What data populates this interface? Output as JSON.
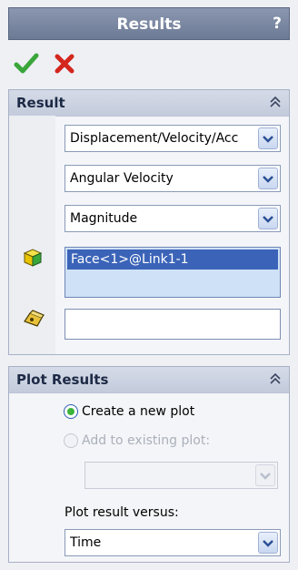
{
  "window": {
    "title": "Results",
    "help_glyph": "?"
  },
  "actions": {
    "ok_icon": "checkmark-icon",
    "cancel_icon": "x-icon",
    "ok_color": "#3aa63a",
    "cancel_color": "#d3261d"
  },
  "result_panel": {
    "title": "Result",
    "collapse_icon": "double-chevron-up-icon",
    "type_select": "Displacement/Velocity/Acc",
    "quantity_select": "Angular Velocity",
    "component_select": "Magnitude",
    "face_icon": "face-selection-icon",
    "selected_items": [
      "Face<1>@Link1-1"
    ],
    "reference_icon": "reference-component-icon",
    "reference_value": ""
  },
  "plot_panel": {
    "title": "Plot Results",
    "collapse_icon": "double-chevron-up-icon",
    "option_new": "Create a new plot",
    "option_existing": "Add to existing plot:",
    "existing_select": "",
    "versus_label": "Plot result versus:",
    "versus_select": "Time"
  }
}
